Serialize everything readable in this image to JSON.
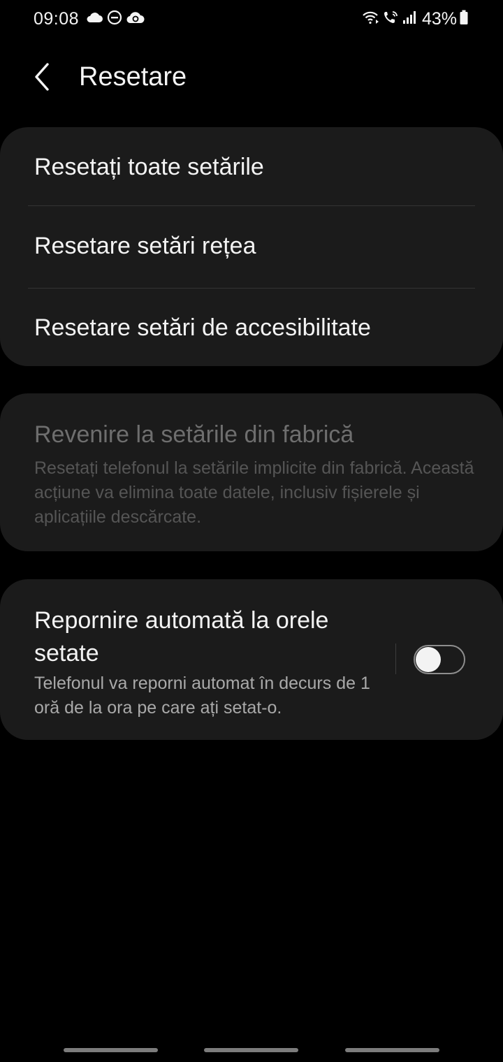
{
  "status_bar": {
    "time": "09:08",
    "battery": "43%",
    "left_icons": [
      "cloud-icon",
      "do-not-disturb-icon",
      "cloud-sync-icon"
    ],
    "right_icons": [
      "wifi-calling-icon",
      "volte-icon",
      "signal-icon",
      "battery-icon"
    ]
  },
  "header": {
    "title": "Resetare",
    "back_icon": "chevron-left-icon"
  },
  "reset_group": {
    "items": [
      {
        "label": "Resetați toate setările"
      },
      {
        "label": "Resetare setări rețea"
      },
      {
        "label": "Resetare setări de accesibilitate"
      }
    ]
  },
  "factory_reset": {
    "title": "Revenire la setările din fabrică",
    "description": "Resetați telefonul la setările implicite din fabrică. Această acțiune va elimina toate datele, inclusiv fișierele și aplicațiile descărcate.",
    "enabled": false
  },
  "auto_restart": {
    "title": "Repornire automată la orele setate",
    "description": "Telefonul va reporni automat în decurs de 1 oră de la ora pe care ați setat-o.",
    "toggle_on": false
  },
  "colors": {
    "background": "#000000",
    "card": "#1b1b1b",
    "text_primary": "#f3f3f3",
    "text_secondary": "#a9a9a9",
    "text_disabled": "#6e6e6e"
  },
  "nav_bar": {
    "handles": [
      "recent-apps-handle",
      "home-handle",
      "back-handle"
    ]
  }
}
